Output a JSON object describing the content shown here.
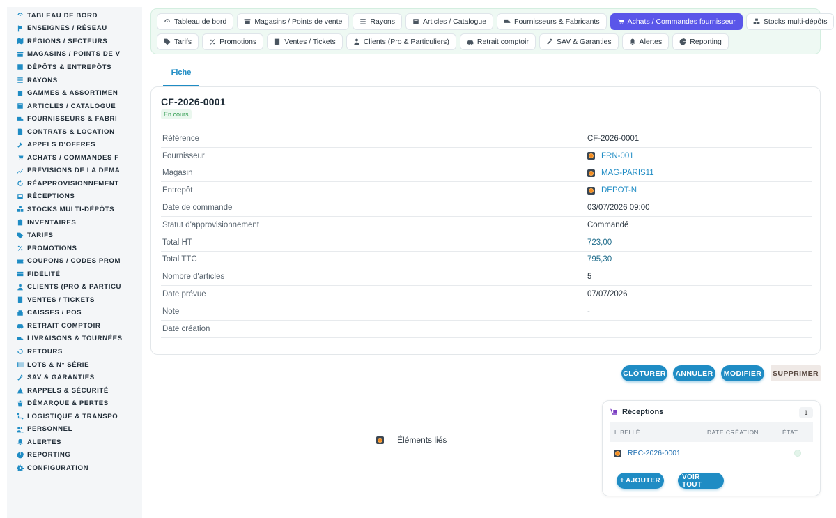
{
  "sidebar": {
    "items": [
      {
        "label": "Tableau de bord",
        "icon": "dashboard-icon"
      },
      {
        "label": "Enseignes / Réseau",
        "icon": "flag-icon"
      },
      {
        "label": "Régions / Secteurs",
        "icon": "map-icon"
      },
      {
        "label": "Magasins / Points de v",
        "icon": "store-icon"
      },
      {
        "label": "Dépôts & Entrepôts",
        "icon": "warehouse-icon"
      },
      {
        "label": "Rayons",
        "icon": "shelf-icon"
      },
      {
        "label": "Gammes & Assortimen",
        "icon": "layers-icon"
      },
      {
        "label": "Articles / Catalogue",
        "icon": "catalog-icon"
      },
      {
        "label": "Fournisseurs & Fabri",
        "icon": "truck-icon"
      },
      {
        "label": "Contrats & Location",
        "icon": "document-icon"
      },
      {
        "label": "Appels d'offres",
        "icon": "gavel-icon"
      },
      {
        "label": "Achats / Commandes F",
        "icon": "cart-icon"
      },
      {
        "label": "Prévisions de la dema",
        "icon": "chart-line-icon"
      },
      {
        "label": "Réapprovisionnement",
        "icon": "refresh-icon"
      },
      {
        "label": "Réceptions",
        "icon": "inbox-icon"
      },
      {
        "label": "Stocks multi-dépôts",
        "icon": "boxes-icon"
      },
      {
        "label": "Inventaires",
        "icon": "clipboard-icon"
      },
      {
        "label": "Tarifs",
        "icon": "tag-icon"
      },
      {
        "label": "Promotions",
        "icon": "percent-icon"
      },
      {
        "label": "Coupons / Codes prom",
        "icon": "ticket-icon"
      },
      {
        "label": "Fidélité",
        "icon": "card-icon"
      },
      {
        "label": "Clients (Pro & Particu",
        "icon": "user-icon"
      },
      {
        "label": "Ventes / Tickets",
        "icon": "receipt-icon"
      },
      {
        "label": "Caisses / POS",
        "icon": "register-icon"
      },
      {
        "label": "Retrait comptoir",
        "icon": "car-icon"
      },
      {
        "label": "Livraisons & Tournées",
        "icon": "delivery-icon"
      },
      {
        "label": "Retours",
        "icon": "undo-icon"
      },
      {
        "label": "Lots & N° série",
        "icon": "barcode-icon"
      },
      {
        "label": "SAV & Garanties",
        "icon": "tools-icon"
      },
      {
        "label": "Rappels & Sécurité",
        "icon": "warning-icon"
      },
      {
        "label": "Démarque & Pertes",
        "icon": "trash-icon"
      },
      {
        "label": "Logistique & Transpo",
        "icon": "route-icon"
      },
      {
        "label": "Personnel",
        "icon": "users-icon"
      },
      {
        "label": "Alertes",
        "icon": "bell-icon"
      },
      {
        "label": "Reporting",
        "icon": "pie-icon"
      },
      {
        "label": "Configuration",
        "icon": "gear-icon"
      }
    ]
  },
  "tabs": {
    "row1": [
      {
        "label": "Tableau de bord",
        "icon": "dashboard-icon",
        "active": false
      },
      {
        "label": "Magasins / Points de vente",
        "icon": "store-icon",
        "active": false
      },
      {
        "label": "Rayons",
        "icon": "shelf-icon",
        "active": false
      },
      {
        "label": "Articles / Catalogue",
        "icon": "catalog-icon",
        "active": false
      },
      {
        "label": "Fournisseurs & Fabricants",
        "icon": "truck-icon",
        "active": false
      },
      {
        "label": "Achats / Commandes fournisseur",
        "icon": "cart-icon",
        "active": true
      },
      {
        "label": "Stocks multi-dépôts",
        "icon": "boxes-icon",
        "active": false
      }
    ],
    "row2": [
      {
        "label": "Tarifs",
        "icon": "tag-icon",
        "active": false
      },
      {
        "label": "Promotions",
        "icon": "percent-icon",
        "active": false
      },
      {
        "label": "Ventes / Tickets",
        "icon": "receipt-icon",
        "active": false
      },
      {
        "label": "Clients (Pro & Particuliers)",
        "icon": "user-icon",
        "active": false
      },
      {
        "label": "Retrait comptoir",
        "icon": "car-icon",
        "active": false
      },
      {
        "label": "SAV & Garanties",
        "icon": "tools-icon",
        "active": false
      },
      {
        "label": "Alertes",
        "icon": "bell-icon",
        "active": false
      },
      {
        "label": "Reporting",
        "icon": "pie-icon",
        "active": false
      }
    ]
  },
  "subtab": {
    "label": "Fiche"
  },
  "record": {
    "title": "CF-2026-0001",
    "status": "En cours",
    "fields": [
      {
        "label": "Référence",
        "value": "CF-2026-0001",
        "type": "text"
      },
      {
        "label": "Fournisseur",
        "value": "FRN-001",
        "type": "link"
      },
      {
        "label": "Magasin",
        "value": "MAG-PARIS11",
        "type": "link"
      },
      {
        "label": "Entrepôt",
        "value": "DEPOT-N",
        "type": "link"
      },
      {
        "label": "Date de commande",
        "value": "03/07/2026 09:00",
        "type": "text"
      },
      {
        "label": "Statut d'approvisionnement",
        "value": "Commandé",
        "type": "text"
      },
      {
        "label": "Total HT",
        "value": "723,00",
        "type": "num"
      },
      {
        "label": "Total TTC",
        "value": "795,30",
        "type": "num"
      },
      {
        "label": "Nombre d'articles",
        "value": "5",
        "type": "text"
      },
      {
        "label": "Date prévue",
        "value": "07/07/2026",
        "type": "text"
      },
      {
        "label": "Note",
        "value": "-",
        "type": "muted"
      },
      {
        "label": "Date création",
        "value": "",
        "type": "text"
      }
    ]
  },
  "actions": {
    "close": "Clôturer",
    "cancel": "Annuler",
    "edit": "Modifier",
    "delete": "Supprimer"
  },
  "linked": {
    "label": "Éléments liés"
  },
  "receptions": {
    "title": "Réceptions",
    "count": "1",
    "columns": {
      "label": "Libellé",
      "date": "Date création",
      "state": "État"
    },
    "rows": [
      {
        "label": "REC-2026-0001",
        "date": "",
        "state": ""
      }
    ],
    "add": "Ajouter",
    "view_all": "Voir tout"
  },
  "colors": {
    "accent": "#1f8cc4",
    "active_tab": "#5a56e9",
    "tab_card_bg": "#eef9f3",
    "success": "#2d9a4c"
  }
}
